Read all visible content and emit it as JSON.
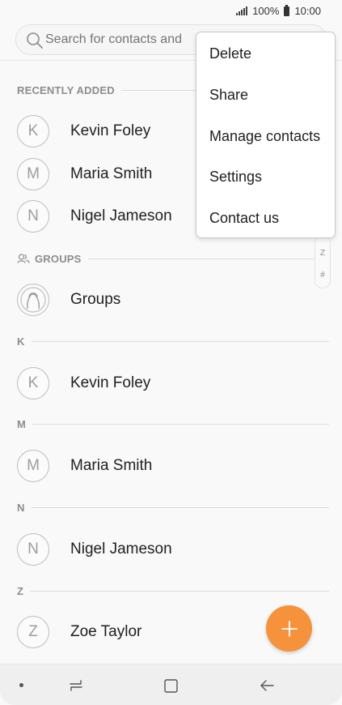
{
  "status_bar": {
    "battery": "100%",
    "time": "10:00"
  },
  "search": {
    "placeholder": "Search for contacts and"
  },
  "sections": {
    "recently_added": "RECENTLY ADDED",
    "groups": "GROUPS",
    "k": "K",
    "m": "M",
    "n": "N",
    "z": "Z"
  },
  "recent_contacts": [
    {
      "initial": "K",
      "name": "Kevin Foley"
    },
    {
      "initial": "M",
      "name": "Maria Smith"
    },
    {
      "initial": "N",
      "name": "Nigel Jameson"
    }
  ],
  "groups_item": {
    "name": "Groups"
  },
  "contacts": {
    "k": {
      "initial": "K",
      "name": "Kevin Foley"
    },
    "m": {
      "initial": "M",
      "name": "Maria Smith"
    },
    "n": {
      "initial": "N",
      "name": "Nigel Jameson"
    },
    "z": {
      "initial": "Z",
      "name": "Zoe Taylor"
    }
  },
  "index_scroller": [
    "Z",
    "#"
  ],
  "popup_menu": {
    "items": [
      "Delete",
      "Share",
      "Manage contacts",
      "Settings",
      "Contact us"
    ]
  },
  "colors": {
    "accent": "#f5923b",
    "text": "#1f1f1f",
    "muted": "#8c8c8c"
  },
  "icons": {
    "search": "search-icon",
    "fab": "plus-icon",
    "group_avatar": "person-outline-icon",
    "groups_header": "groups-icon",
    "nav_recent": "recent-apps-icon",
    "nav_home": "home-icon",
    "nav_back": "back-icon"
  }
}
